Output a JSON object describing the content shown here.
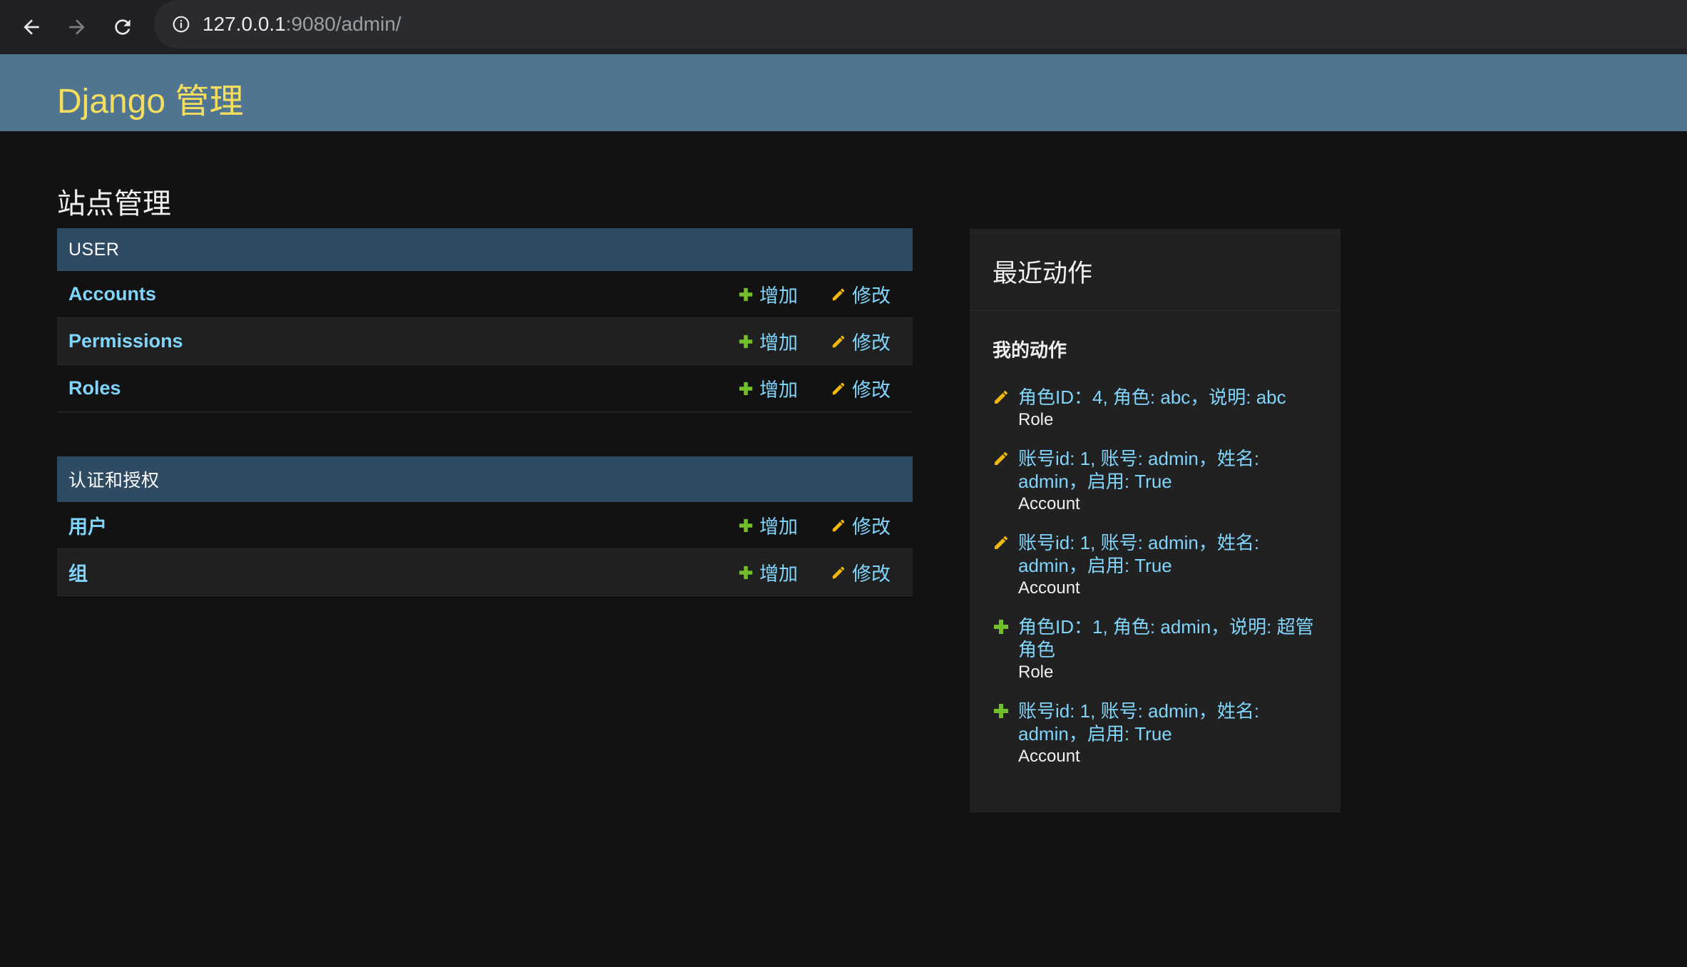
{
  "browser": {
    "url_host": "127.0.0.1",
    "url_rest": ":9080/admin/"
  },
  "header": {
    "brand": "Django 管理"
  },
  "page": {
    "title": "站点管理"
  },
  "modules": [
    {
      "caption": "USER",
      "rows": [
        {
          "name": "Accounts",
          "add": "增加",
          "change": "修改"
        },
        {
          "name": "Permissions",
          "add": "增加",
          "change": "修改"
        },
        {
          "name": "Roles",
          "add": "增加",
          "change": "修改"
        }
      ]
    },
    {
      "caption": "认证和授权",
      "rows": [
        {
          "name": "用户",
          "add": "增加",
          "change": "修改"
        },
        {
          "name": "组",
          "add": "增加",
          "change": "修改"
        }
      ]
    }
  ],
  "recent": {
    "title": "最近动作",
    "subtitle": "我的动作",
    "items": [
      {
        "icon": "pencil-icon",
        "text": "角色ID：4, 角色: abc，说明: abc",
        "type": "Role"
      },
      {
        "icon": "pencil-icon",
        "text": "账号id: 1, 账号: admin，姓名: admin，启用: True",
        "type": "Account"
      },
      {
        "icon": "pencil-icon",
        "text": "账号id: 1, 账号: admin，姓名: admin，启用: True",
        "type": "Account"
      },
      {
        "icon": "plus-icon",
        "text": "角色ID：1, 角色: admin，说明: 超管角色",
        "type": "Role"
      },
      {
        "icon": "plus-icon",
        "text": "账号id: 1, 账号: admin，姓名: admin，启用: True",
        "type": "Account"
      }
    ]
  },
  "colors": {
    "header_bg": "#4f7591",
    "brand": "#f5dd5d",
    "caption_bg": "#2f4b63",
    "link": "#81d4fa",
    "add_icon": "#70bf2b",
    "change_icon": "#efb80b"
  }
}
